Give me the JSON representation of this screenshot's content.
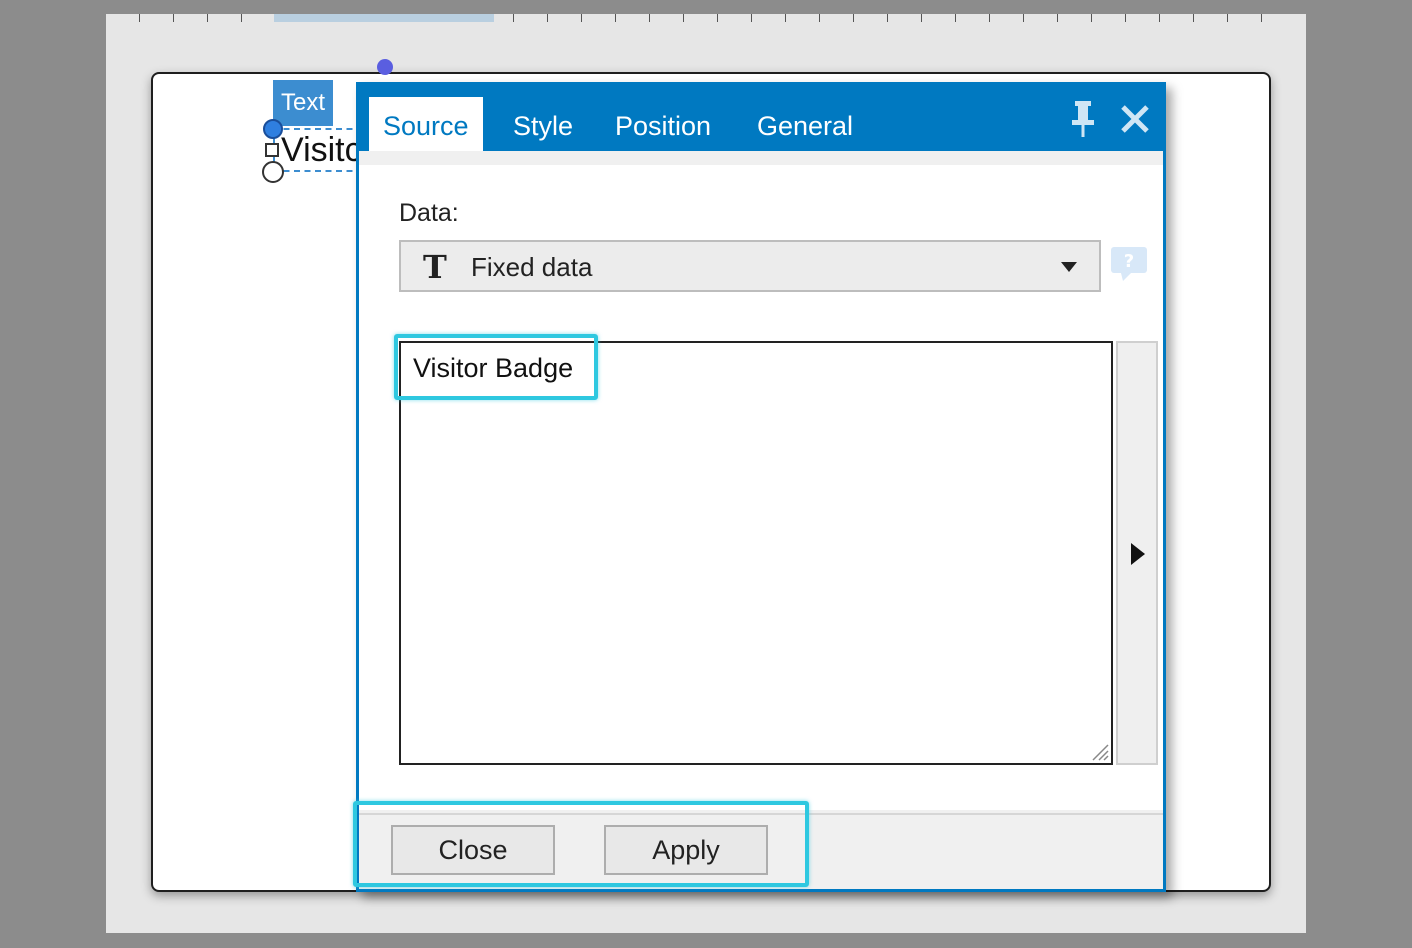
{
  "canvas": {
    "object_tag": "Text",
    "object_preview_text": "Visitc"
  },
  "dialog": {
    "tabs": [
      {
        "label": "Source",
        "active": true
      },
      {
        "label": "Style",
        "active": false
      },
      {
        "label": "Position",
        "active": false
      },
      {
        "label": "General",
        "active": false
      }
    ],
    "pin_icon": "pin-icon",
    "close_icon": "close-icon",
    "data_label": "Data:",
    "data_source": {
      "icon": "T",
      "selected": "Fixed data"
    },
    "help_icon": "help-icon",
    "text_value": "Visitor Badge",
    "side_expand_icon": "play-arrow-icon",
    "buttons": {
      "close": "Close",
      "apply": "Apply"
    }
  },
  "colors": {
    "accent": "#0079c1",
    "highlight": "#2ec8e0"
  }
}
